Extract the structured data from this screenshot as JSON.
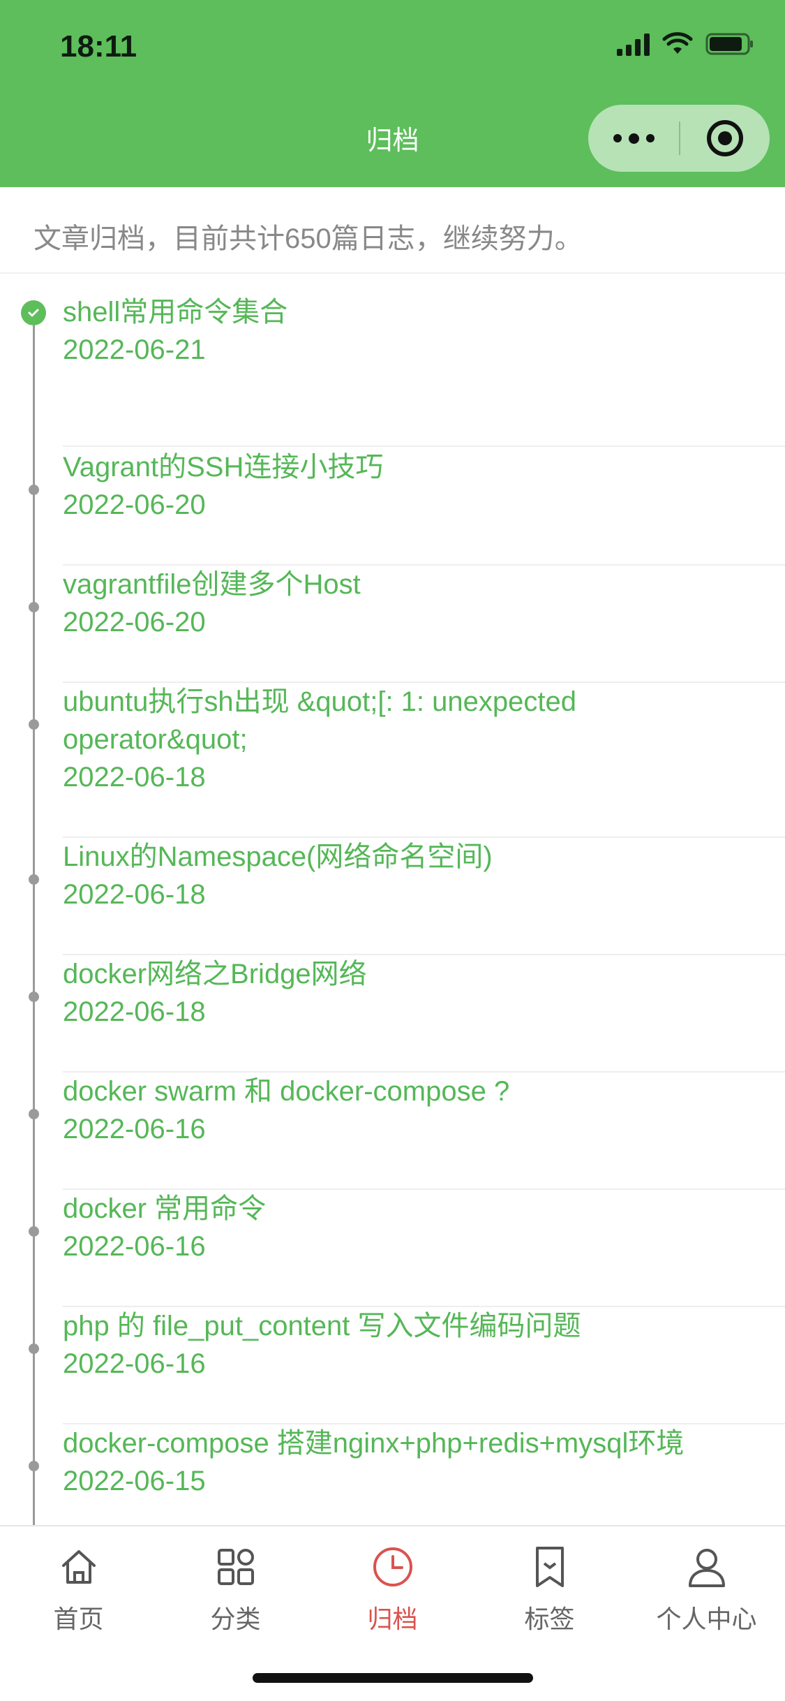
{
  "status": {
    "time": "18:11"
  },
  "nav": {
    "title": "归档"
  },
  "summary": "文章归档，目前共计650篇日志，继续努力。",
  "posts": [
    {
      "title": "shell常用命令集合",
      "date": "2022-06-21"
    },
    {
      "title": "Vagrant的SSH连接小技巧",
      "date": "2022-06-20"
    },
    {
      "title": "vagrantfile创建多个Host",
      "date": "2022-06-20"
    },
    {
      "title": "ubuntu执行sh出现 &quot;[: 1: unexpected operator&quot;",
      "date": "2022-06-18"
    },
    {
      "title": "Linux的Namespace(网络命名空间)",
      "date": "2022-06-18"
    },
    {
      "title": "docker网络之Bridge网络",
      "date": "2022-06-18"
    },
    {
      "title": "docker swarm 和 docker-compose ?",
      "date": "2022-06-16"
    },
    {
      "title": "docker 常用命令",
      "date": "2022-06-16"
    },
    {
      "title": "php 的 file_put_content 写入文件编码问题",
      "date": "2022-06-16"
    },
    {
      "title": "docker-compose 搭建nginx+php+redis+mysql环境",
      "date": "2022-06-15"
    }
  ],
  "tabs": [
    {
      "label": "首页",
      "icon": "home-icon"
    },
    {
      "label": "分类",
      "icon": "grid-icon"
    },
    {
      "label": "归档",
      "icon": "clock-icon",
      "active": true
    },
    {
      "label": "标签",
      "icon": "bookmark-icon"
    },
    {
      "label": "个人中心",
      "icon": "user-icon"
    }
  ],
  "colors": {
    "brand": "#5dbe5b",
    "link": "#55b757",
    "active_tab": "#d9534f"
  }
}
